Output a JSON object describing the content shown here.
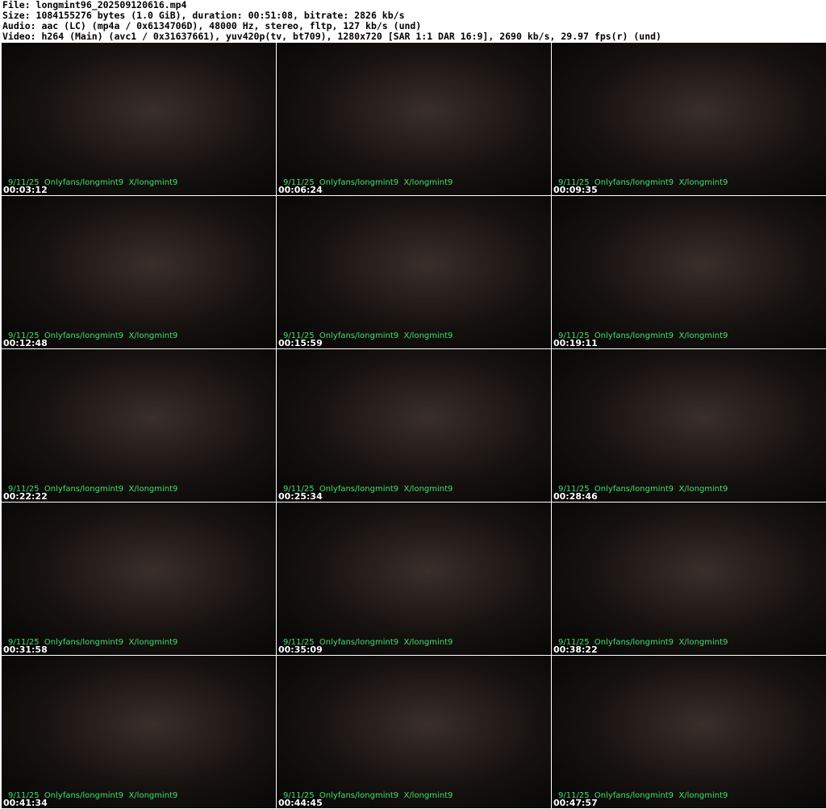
{
  "header": {
    "file": "File: longmint96_202509120616.mp4",
    "size": "Size: 1084155276 bytes (1.0 GiB), duration: 00:51:08, bitrate: 2826 kb/s",
    "audio": "Audio: aac (LC) (mp4a / 0x6134706D), 48000 Hz, stereo, fltp, 127 kb/s (und)",
    "video": "Video: h264 (Main) (avc1 / 0x31637661), yuv420p(tv, bt709), 1280x720 [SAR 1:1 DAR 16:9], 2690 kb/s, 29.97 fps(r) (und)"
  },
  "watermark": "9/11/25  Onlyfans/longmint9  X/longmint9",
  "frames": [
    "00:03:12",
    "00:06:24",
    "00:09:35",
    "00:12:48",
    "00:15:59",
    "00:19:11",
    "00:22:22",
    "00:25:34",
    "00:28:46",
    "00:31:58",
    "00:35:09",
    "00:38:22",
    "00:41:34",
    "00:44:45",
    "00:47:57"
  ]
}
